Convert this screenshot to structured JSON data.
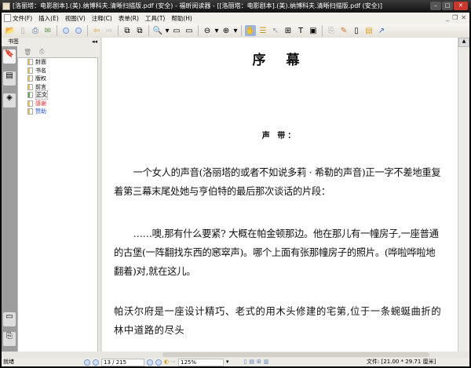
{
  "window": {
    "title": "[洛丽塔：电影剧本].(美).纳博科夫.清晰扫描版.pdf (安全) - 福昕阅读器 - [[洛丽塔：电影剧本].(美).纳博科夫.清晰扫描版.pdf (安全)]"
  },
  "menu": [
    "文件(F)",
    "插入(E)",
    "视图(V)",
    "注释(C)",
    "表单(R)",
    "工具(T)",
    "帮助(H)"
  ],
  "panel": {
    "title": "书签",
    "bookmarks": [
      {
        "label": "封面",
        "color": "#000000"
      },
      {
        "label": "书名",
        "color": "#000000"
      },
      {
        "label": "版权",
        "color": "#000000"
      },
      {
        "label": "前言",
        "color": "#000000"
      },
      {
        "label": "正文",
        "color": "#000000"
      },
      {
        "label": "感谢",
        "color": "#e02020"
      },
      {
        "label": "赞助",
        "color": "#2050e0"
      }
    ]
  },
  "document": {
    "title": "序 幕",
    "subtitle": "声 带：",
    "paragraphs": [
      "一个女人的声音(洛丽塔的或者不如说多莉 · 希勒的声音)正一字不差地重复着第三幕末尾处她与亨伯特的最后那次谈话的片段：",
      "……噢,那有什么要紧? 大概在帕金顿那边。他在那儿有一幢房子,一座普通的古堡(一阵翻找东西的窸窣声)。哪个上面有张那幢房子的照片。(哗啦哗啦地翻着)对,就在这儿。",
      "帕沃尔府是一座设计精巧、老式的用木头修建的宅第,位于一条蜿蜒曲折的林中道路的尽头"
    ]
  },
  "status": {
    "ready": "就绪",
    "page": "13 / 215",
    "zoom": "125%",
    "file_info": "文件: [21.00 * 29.71 厘米]"
  }
}
